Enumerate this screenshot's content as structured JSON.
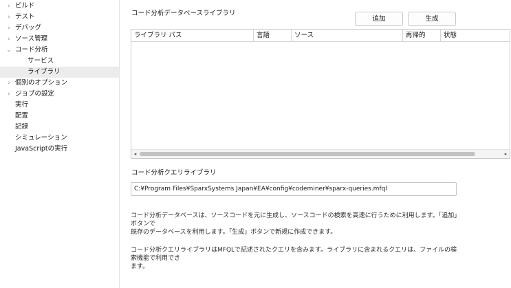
{
  "sidebar": {
    "items": [
      {
        "label": "ビルド",
        "arrow": "›",
        "indent": 0
      },
      {
        "label": "テスト",
        "arrow": "›",
        "indent": 0
      },
      {
        "label": "デバッグ",
        "arrow": "›",
        "indent": 0
      },
      {
        "label": "ソース管理",
        "arrow": "›",
        "indent": 0
      },
      {
        "label": "コード分析",
        "arrow": "⌄",
        "indent": 0
      },
      {
        "label": "サービス",
        "arrow": "",
        "indent": 2
      },
      {
        "label": "ライブラリ",
        "arrow": "",
        "indent": 2,
        "selected": true
      },
      {
        "label": "個別のオプション",
        "arrow": "›",
        "indent": 0
      },
      {
        "label": "ジョブの設定",
        "arrow": "›",
        "indent": 0
      },
      {
        "label": "実行",
        "arrow": "",
        "indent": 1
      },
      {
        "label": "配置",
        "arrow": "",
        "indent": 1
      },
      {
        "label": "記録",
        "arrow": "",
        "indent": 1
      },
      {
        "label": "シミュレーション",
        "arrow": "",
        "indent": 1
      },
      {
        "label": "JavaScriptの実行",
        "arrow": "",
        "indent": 1
      }
    ]
  },
  "main": {
    "library_title": "コード分析データベースライブラリ",
    "add_label": "追加",
    "generate_label": "生成",
    "table": {
      "columns": [
        "ライブラリ パス",
        "言語",
        "ソース",
        "再帰的",
        "状態"
      ],
      "rows": []
    },
    "query_title": "コード分析クエリライブラリ",
    "query_path": "C:¥Program Files¥SparxSystems Japan¥EA¥config¥codeminer¥sparx-queries.mfql",
    "desc1_line1": "コード分析データベースは、ソースコードを元に生成し、ソースコードの検索を高速に行うために利用します。「追加」ボタンで",
    "desc1_line2": "既存のデータベースを利用します。「生成」ボタンで新規に作成できます。",
    "desc2_line1": "コード分析クエリライブラリはMFQLで記述されたクエリを含みます。ライブラリに含まれるクエリは、ファイルの検索機能で利用でき",
    "desc2_line2": "ます。"
  },
  "icons": {
    "scroll_left": "◂",
    "scroll_right": "▸"
  }
}
